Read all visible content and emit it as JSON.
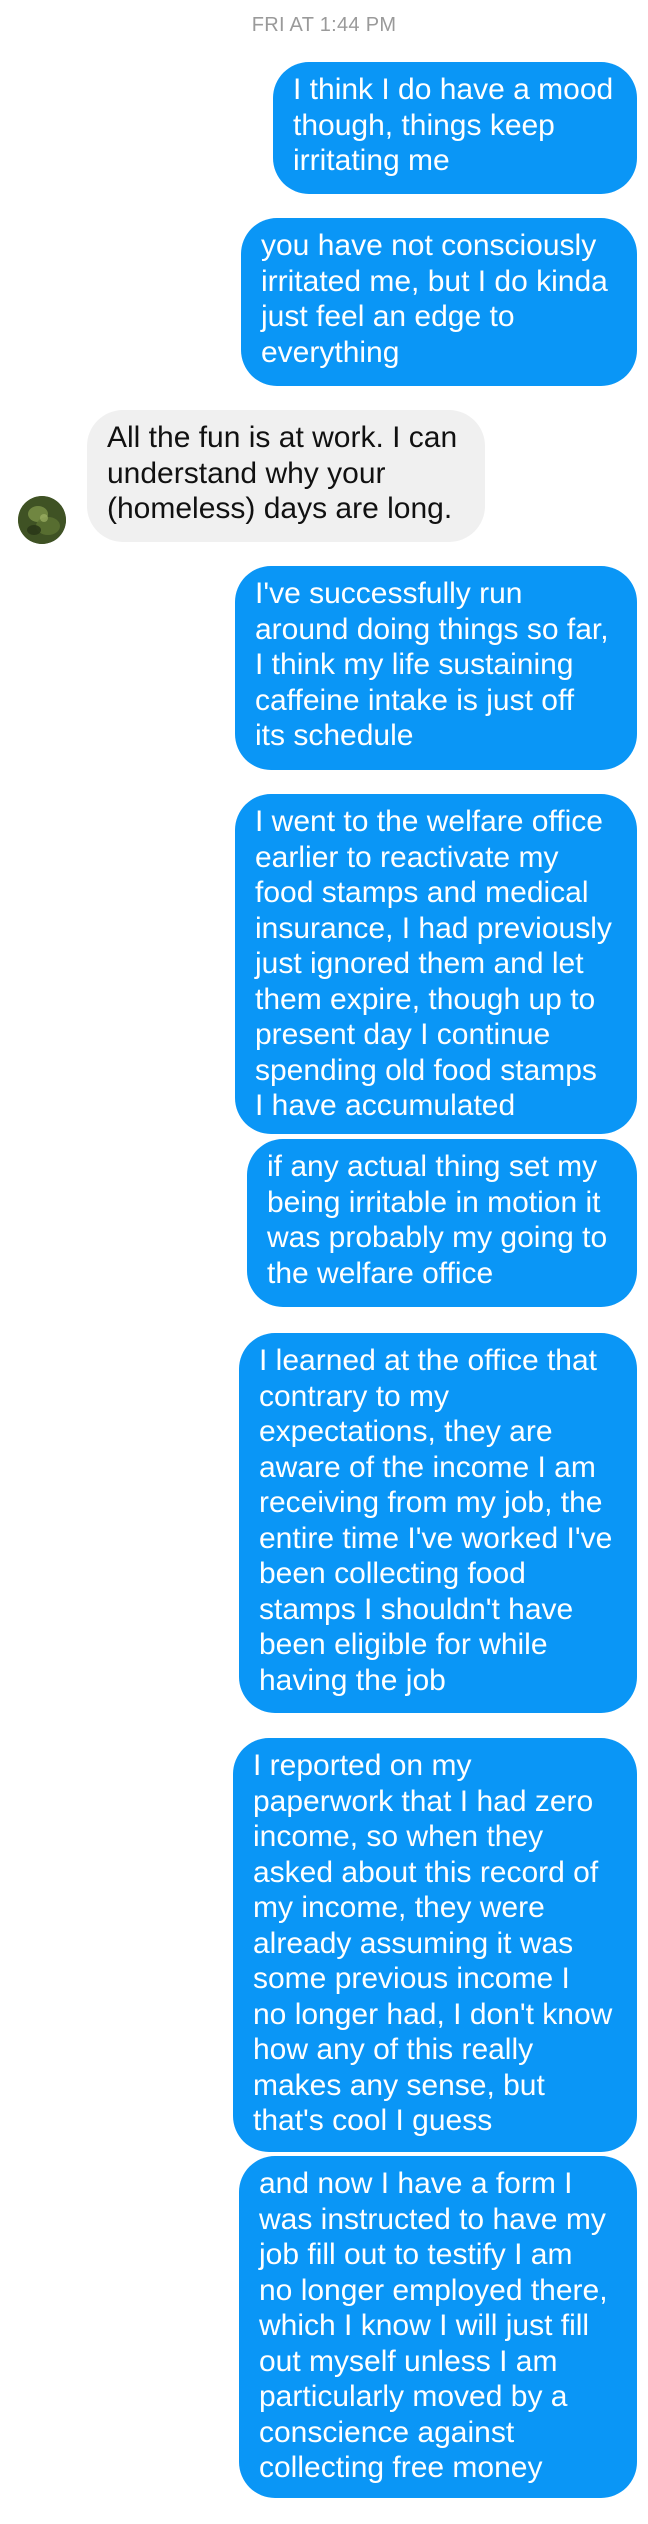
{
  "timestamp": "FRI AT 1:44 PM",
  "messages": [
    {
      "from": "me",
      "text": "I think I do have a mood\nthough, things keep\nirritating me"
    },
    {
      "from": "me",
      "text": "you have not consciously\nirritated me, but I do kinda\njust feel an edge to\neverything"
    },
    {
      "from": "them",
      "text": "All the fun is at work. I can\nunderstand why your\n(homeless) days are long."
    },
    {
      "from": "me",
      "text": "I've successfully run\naround doing things so far,\nI think my life sustaining\ncaffeine intake is just off\nits schedule"
    },
    {
      "from": "me",
      "text": "I went to the welfare office\nearlier to reactivate my\nfood stamps and medical\ninsurance, I had previously\njust ignored them and let\nthem expire, though up to\npresent day I continue\nspending old food stamps\nI have accumulated"
    },
    {
      "from": "me",
      "text": "if any actual thing set my\nbeing irritable in motion it\nwas probably my going to\nthe welfare office"
    },
    {
      "from": "me",
      "text": "I learned at the office that\ncontrary to my\nexpectations, they are\naware of the income I am\nreceiving from my job, the\nentire time I've worked I've\nbeen collecting food\nstamps I shouldn't have\nbeen eligible for while\nhaving the job"
    },
    {
      "from": "me",
      "text": "I reported on my\npaperwork that I had zero\nincome, so when they\nasked about this record of\nmy income, they were\nalready assuming it was\nsome previous income I\nno longer had, I don't know\nhow any of this really\nmakes any sense, but\nthat's cool I guess"
    },
    {
      "from": "me",
      "text": "and now I have a form I\nwas instructed to have my\njob fill out to testify I am\nno longer employed there,\nwhich I know I will just fill\nout myself unless I am\nparticularly moved by a\nconscience against\ncollecting free money"
    }
  ],
  "colors": {
    "outgoing_bubble": "#0a96f6",
    "incoming_bubble": "#f0f0f0",
    "timestamp": "#9a9a9a"
  },
  "icons": {
    "contact_avatar": "avatar"
  }
}
